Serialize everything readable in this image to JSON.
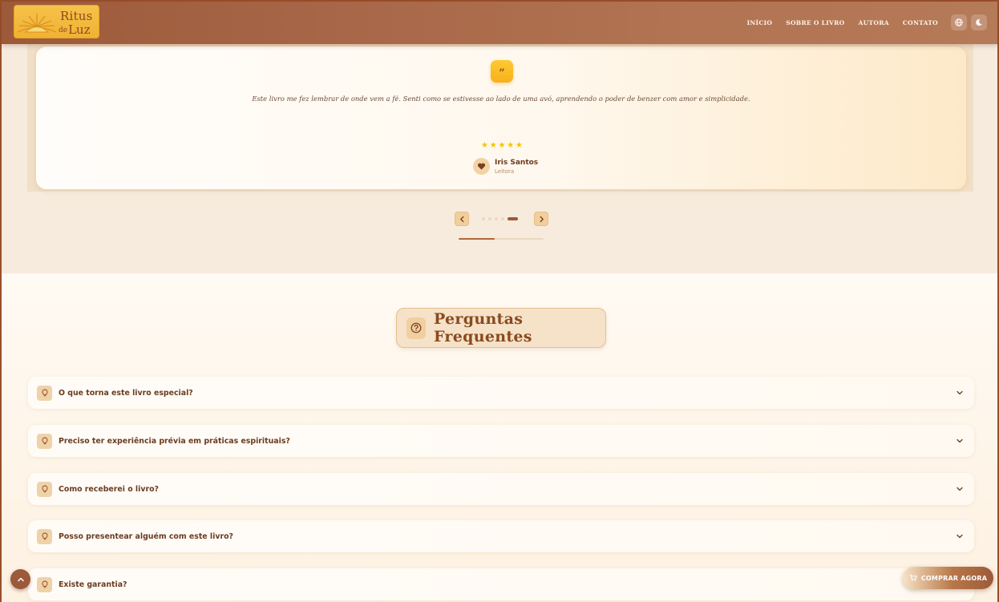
{
  "brand": {
    "name_line1": "Ritus",
    "name_line2_prefix": "de",
    "name_line2": "Luz"
  },
  "nav": {
    "items": [
      {
        "label": "INÍCIO"
      },
      {
        "label": "SOBRE O LIVRO"
      },
      {
        "label": "AUTORA"
      },
      {
        "label": "CONTATO"
      }
    ],
    "language_icon": "globe-icon",
    "theme_icon": "moon-icon"
  },
  "testimonial": {
    "quote_mark": "”",
    "text": "Este livro me fez lembrar de onde vem a fé. Senti como se estivesse ao lado de uma avó, aprendendo o poder de benzer com amor e simplicidade.",
    "rating": 5,
    "stars": [
      "★",
      "★",
      "★",
      "★",
      "★"
    ],
    "author_name": "Iris Santos",
    "author_role": "Leitora",
    "slide_count": 5,
    "active_slide": 5,
    "progress": 0.42
  },
  "faq": {
    "title": "Perguntas Frequentes",
    "items": [
      {
        "question": "O que torna este livro especial?"
      },
      {
        "question": "Preciso ter experiência prévia em práticas espirituais?"
      },
      {
        "question": "Como receberei o livro?"
      },
      {
        "question": "Posso presentear alguém com este livro?"
      },
      {
        "question": "Existe garantia?"
      }
    ]
  },
  "buy_button": {
    "label": "COMPRAR AGORA"
  },
  "colors": {
    "brand_brown": "#9c5a3a",
    "gold": "#f5c24a",
    "star": "#f5c400",
    "cream": "#fdf6ec"
  }
}
